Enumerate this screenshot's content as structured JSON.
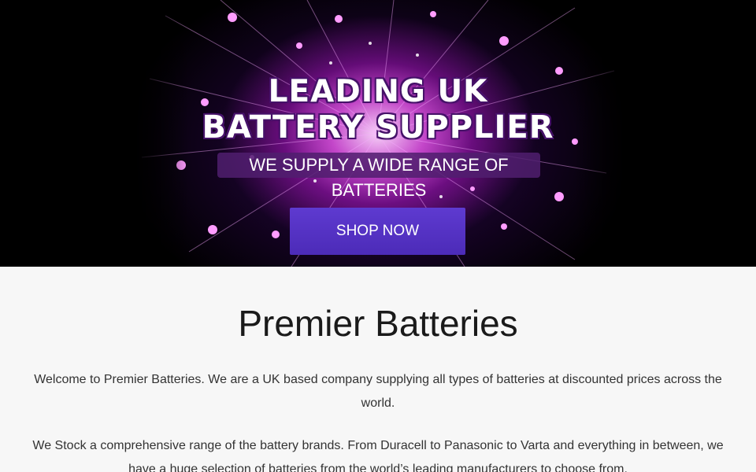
{
  "hero": {
    "headline_line1": "LEADING UK",
    "headline_line2": "BATTERY SUPPLIER",
    "tagline": "WE SUPPLY A WIDE RANGE OF BATTERIES",
    "cta_label": "SHOP NOW",
    "accent_color": "#5a38c8"
  },
  "main": {
    "title": "Premier Batteries",
    "paragraphs": [
      "Welcome to Premier Batteries. We are a UK based company supplying all types of batteries at discounted prices across the world.",
      "We Stock a comprehensive range of the battery brands. From Duracell to Panasonic to Varta and everything in between, we have a huge selection of batteries from the world’s leading manufacturers to choose from."
    ]
  }
}
